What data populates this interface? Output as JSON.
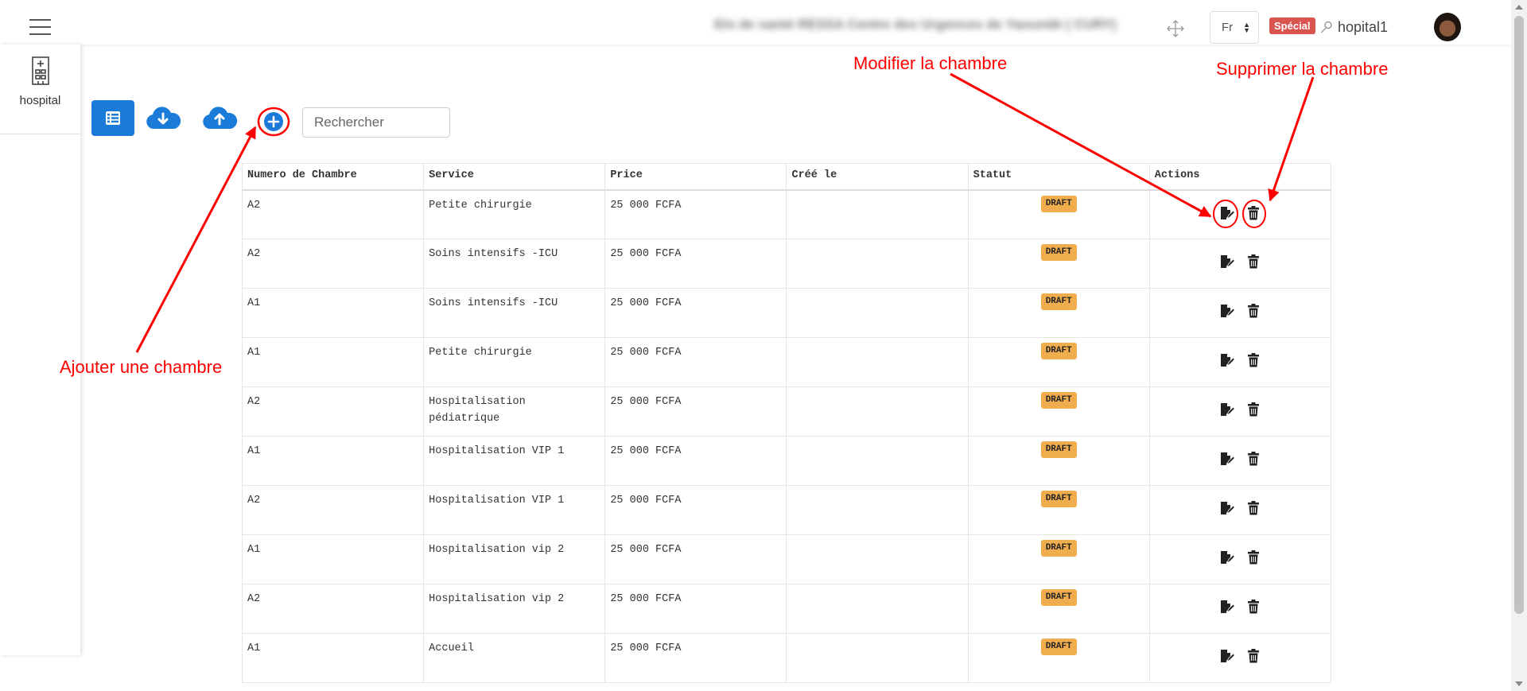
{
  "header": {
    "org_name": "Ets de santé RESSA Centre des Urgences de Yaoundé ( CURY)",
    "lang": "Fr",
    "special_badge": "Spécial",
    "username": "hopital1"
  },
  "sidebar": {
    "label": "hospital"
  },
  "toolbar": {
    "search_placeholder": "Rechercher"
  },
  "table": {
    "columns": [
      "Numero de Chambre",
      "Service",
      "Price",
      "Créé le",
      "Statut",
      "Actions"
    ],
    "rows": [
      {
        "room": "A2",
        "service": "Petite chirurgie",
        "price": "25 000 FCFA",
        "created": "",
        "status": "DRAFT"
      },
      {
        "room": "A2",
        "service": "Soins intensifs -ICU",
        "price": "25 000 FCFA",
        "created": "",
        "status": "DRAFT"
      },
      {
        "room": "A1",
        "service": "Soins intensifs -ICU",
        "price": "25 000 FCFA",
        "created": "",
        "status": "DRAFT"
      },
      {
        "room": "A1",
        "service": "Petite chirurgie",
        "price": "25 000 FCFA",
        "created": "",
        "status": "DRAFT"
      },
      {
        "room": "A2",
        "service": "Hospitalisation pédiatrique",
        "price": "25 000 FCFA",
        "created": "",
        "status": "DRAFT"
      },
      {
        "room": "A1",
        "service": "Hospitalisation VIP 1",
        "price": "25 000 FCFA",
        "created": "",
        "status": "DRAFT"
      },
      {
        "room": "A2",
        "service": "Hospitalisation VIP 1",
        "price": "25 000 FCFA",
        "created": "",
        "status": "DRAFT"
      },
      {
        "room": "A1",
        "service": "Hospitalisation vip 2",
        "price": "25 000 FCFA",
        "created": "",
        "status": "DRAFT"
      },
      {
        "room": "A2",
        "service": "Hospitalisation vip 2",
        "price": "25 000 FCFA",
        "created": "",
        "status": "DRAFT"
      },
      {
        "room": "A1",
        "service": "Accueil",
        "price": "25 000 FCFA",
        "created": "",
        "status": "DRAFT"
      }
    ]
  },
  "annotations": {
    "add": "Ajouter une chambre",
    "edit": "Modifier la chambre",
    "delete": "Supprimer la chambre",
    "color": "#ff0000"
  },
  "colors": {
    "primary": "#1a7bd9",
    "draft": "#f0ad4e",
    "special": "#d9534f"
  }
}
